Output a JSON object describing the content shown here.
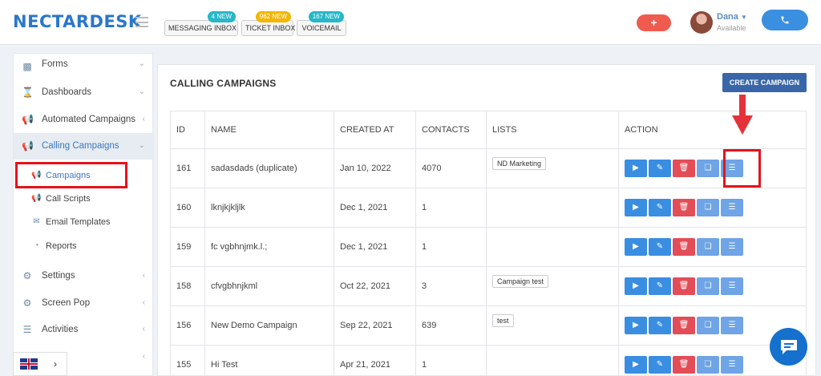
{
  "app": {
    "logo_text": "NECTARDESK"
  },
  "topbar": {
    "inboxes": [
      {
        "label": "MESSAGING INBOX",
        "badge": "4 NEW",
        "badge_color": "#27b7c8"
      },
      {
        "label": "TICKET INBOX",
        "badge": "962 NEW",
        "badge_color": "#f2b705"
      },
      {
        "label": "VOICEMAIL",
        "badge": "167 NEW",
        "badge_color": "#27b7c8"
      }
    ],
    "add_button": "+",
    "user": {
      "name": "Dana",
      "status": "Available"
    }
  },
  "sidebar": {
    "items": [
      {
        "label": "Forms",
        "icon": "folder-icon"
      },
      {
        "label": "Dashboards",
        "icon": "hourglass-icon"
      },
      {
        "label": "Automated Campaigns",
        "icon": "megaphone-icon"
      },
      {
        "label": "Calling Campaigns",
        "icon": "megaphone-icon"
      },
      {
        "label": "Settings",
        "icon": "gear-icon"
      },
      {
        "label": "Screen Pop",
        "icon": "gear-icon"
      },
      {
        "label": "Activities",
        "icon": "list-icon"
      }
    ],
    "sub_items": [
      {
        "label": "Campaigns",
        "icon": "megaphone-icon"
      },
      {
        "label": "Call Scripts",
        "icon": "megaphone-icon"
      },
      {
        "label": "Email Templates",
        "icon": "envelope-icon"
      },
      {
        "label": "Reports",
        "icon": "pie-chart-icon"
      }
    ]
  },
  "main": {
    "title": "CALLING CAMPAIGNS",
    "create_button": "CREATE CAMPAIGN",
    "table": {
      "columns": [
        "ID",
        "NAME",
        "CREATED AT",
        "CONTACTS",
        "LISTS",
        "ACTION"
      ],
      "rows": [
        {
          "id": "161",
          "name": "sadasdads (duplicate)",
          "created_at": "Jan 10, 2022",
          "contacts": "4070",
          "list": "ND Marketing"
        },
        {
          "id": "160",
          "name": "lknjkjkljlk",
          "created_at": "Dec 1, 2021",
          "contacts": "1",
          "list": ""
        },
        {
          "id": "159",
          "name": "fc vgbhnjmk.l.;",
          "created_at": "Dec 1, 2021",
          "contacts": "1",
          "list": ""
        },
        {
          "id": "158",
          "name": "cfvgbhnjkml",
          "created_at": "Oct 22, 2021",
          "contacts": "3",
          "list": "Campaign test"
        },
        {
          "id": "156",
          "name": "New Demo Campaign",
          "created_at": "Sep 22, 2021",
          "contacts": "639",
          "list": "test"
        },
        {
          "id": "155",
          "name": "Hi Test",
          "created_at": "Apr 21, 2021",
          "contacts": "1",
          "list": ""
        }
      ]
    }
  },
  "colors": {
    "primary": "#3a8ee2",
    "danger": "#e34d57",
    "highlight": "#e5131b"
  }
}
